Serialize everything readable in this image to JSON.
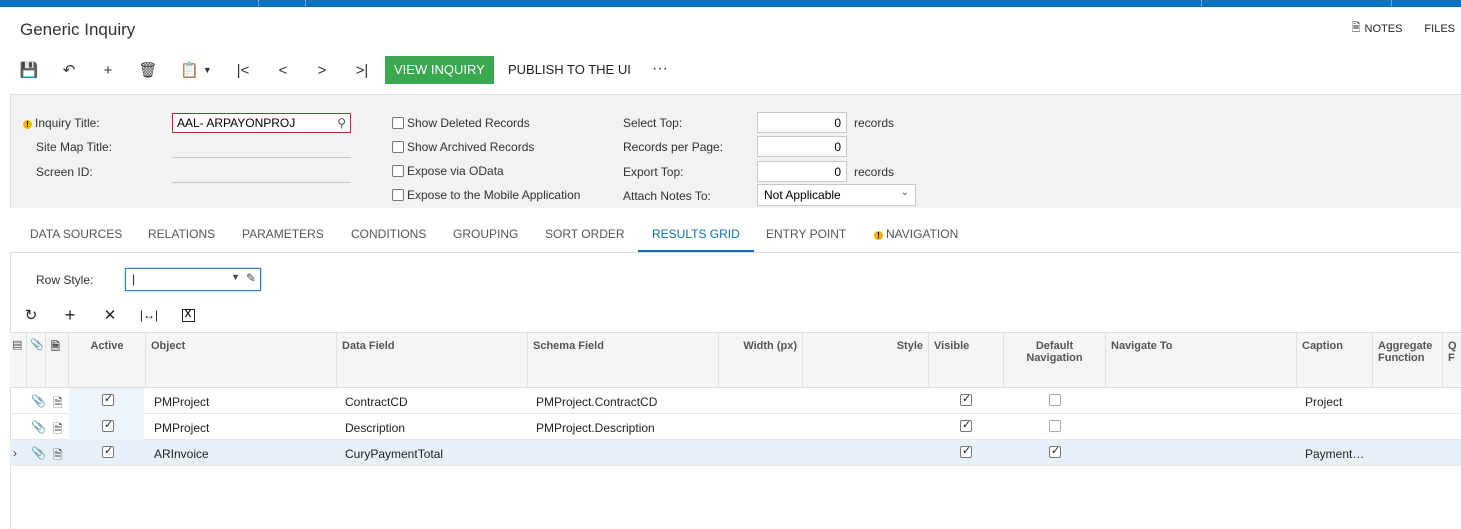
{
  "page": {
    "title": "Generic Inquiry"
  },
  "top_links": {
    "notes": "NOTES",
    "files": "FILES"
  },
  "toolbar": {
    "view_inquiry": "VIEW INQUIRY",
    "publish": "PUBLISH TO THE UI",
    "more": "···"
  },
  "form": {
    "inquiry_title_label": "Inquiry Title:",
    "inquiry_title_value": "AAL- ARPAYONPROJ",
    "site_map_title_label": "Site Map Title:",
    "screen_id_label": "Screen ID:",
    "show_deleted": "Show Deleted Records",
    "show_archived": "Show Archived Records",
    "expose_odata": "Expose via OData",
    "expose_mobile": "Expose to the Mobile Application",
    "select_top_label": "Select Top:",
    "select_top_value": "0",
    "records_per_page_label": "Records per Page:",
    "records_per_page_value": "0",
    "export_top_label": "Export Top:",
    "export_top_value": "0",
    "records_unit": "records",
    "attach_notes_label": "Attach Notes To:",
    "attach_notes_value": "Not Applicable"
  },
  "tabs": [
    {
      "label": "DATA SOURCES"
    },
    {
      "label": "RELATIONS"
    },
    {
      "label": "PARAMETERS"
    },
    {
      "label": "CONDITIONS"
    },
    {
      "label": "GROUPING"
    },
    {
      "label": "SORT ORDER"
    },
    {
      "label": "RESULTS GRID"
    },
    {
      "label": "ENTRY POINT"
    },
    {
      "label": "NAVIGATION"
    }
  ],
  "grid": {
    "row_style_label": "Row Style:",
    "row_style_value": "|",
    "headers": {
      "active": "Active",
      "object": "Object",
      "data_field": "Data Field",
      "schema_field": "Schema Field",
      "width": "Width (px)",
      "style": "Style",
      "visible": "Visible",
      "default_nav_1": "Default",
      "default_nav_2": "Navigation",
      "navigate_to": "Navigate To",
      "caption": "Caption",
      "aggregate_1": "Aggregate",
      "aggregate_2": "Function",
      "q_1": "Q",
      "q_2": "F"
    },
    "rows": [
      {
        "object": "PMProject",
        "data_field": "ContractCD",
        "schema_field": "PMProject.ContractCD",
        "caption": "Project"
      },
      {
        "object": "PMProject",
        "data_field": "Description",
        "schema_field": "PMProject.Description",
        "caption": ""
      },
      {
        "object": "ARInvoice",
        "data_field": "CuryPaymentTotal",
        "schema_field": "",
        "caption": "Payment…"
      }
    ]
  }
}
